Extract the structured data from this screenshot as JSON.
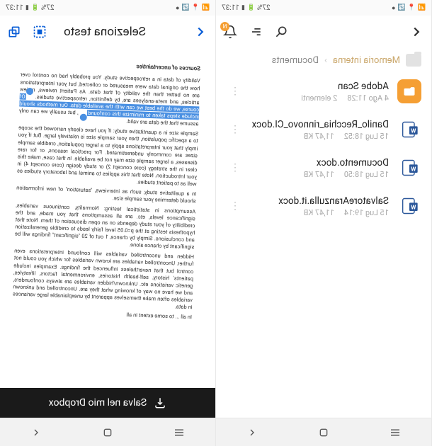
{
  "status_bar": {
    "time": "11:37",
    "battery_text": "27%"
  },
  "left": {
    "toolbar": {
      "title": "Seleziona testo"
    },
    "document": {
      "heading": "Sources of uncertainties",
      "p1": "Validity of data in a retrospective study. You probably had no control over how the original data were measured or collected, but your interpretations are no better than the validity of that data. As Patient reviews, review articles, and meta-analyses are, by definition, retrospective studies.",
      "highlighted": "Of course, we do the best we can with the available data. Our methods should include steps taken to minimize this confound",
      "p1b": ", but usually we can only assume that the data are valid.",
      "p2": "Sample size in a quantitative study: If you have clearly narrowed the scope to a specific population, then your sample size is relatively large. But if you imply that your interpretations apply to a larger population, credible sample sizes are commonly underestimated. For practical reasons, or for rare diseases, a larger sample size may not be available. In that case, make this clear in the strategy (core concept 2) or study design (core concept 4) in your Introduction. Note that this applies to animal and laboratory studies as well as to patient studies.",
      "p3": "In a qualitative study, such as interviews, \"saturation\" of new information should determine your sample size.",
      "p4": "Assumptions in statistical testing: Normality, continuous variables, significance levels, etc. are all assumptions that you made, and the credibility of your study depends on an open discussion of them. Note that hypothesis testing at the p=0.05 level fairly leads to credible generalization and conclusions. Simply by chance, 1 out of 20 \"significant\" findings will be significant by chance alone.",
      "p5": "Hidden and uncontrolled variables will confound interpretations even further. Uncontrolled variables are known variables for which you could not control but that nevertheless influenced the findings. Examples include patients' history, self-health histories, environmental factors, lifestyles, genetic variations etc. Unknown/hidden variables are always confounders, and we have no way of knowing what they are. Uncontrolled and unknown variables often make themselves apparent by unexplainable large variances in data.",
      "p6": "In all ... to some extent in all"
    },
    "save_label": "Salva nel mio Dropbox"
  },
  "right": {
    "breadcrumb": {
      "root": "Memoria interna",
      "current": "Documents"
    },
    "notif_badge": "N",
    "files": [
      {
        "name": "Adobe Scan",
        "date": "4 Ago 11:28",
        "size": "2 elementi",
        "type": "folder"
      },
      {
        "name": "Danilo_Recchia_rinnovo_CI.docx",
        "date": "15 Lug 18:52",
        "size": "11,47 KB",
        "type": "docx"
      },
      {
        "name": "Documento.docx",
        "date": "15 Lug 18:50",
        "size": "11,47 KB",
        "type": "docx"
      },
      {
        "name": "SalvatoreAranzulla.it.docx",
        "date": "15 Lug 19:14",
        "size": "11,47 KB",
        "type": "docx"
      }
    ]
  },
  "icons": {
    "back": "chevron-left",
    "copy": "copy",
    "select_all": "select-all",
    "download": "download",
    "search": "search",
    "menu": "menu",
    "bell": "bell",
    "more": "more",
    "nav_recent": "recent",
    "nav_home": "home",
    "nav_back": "back"
  }
}
